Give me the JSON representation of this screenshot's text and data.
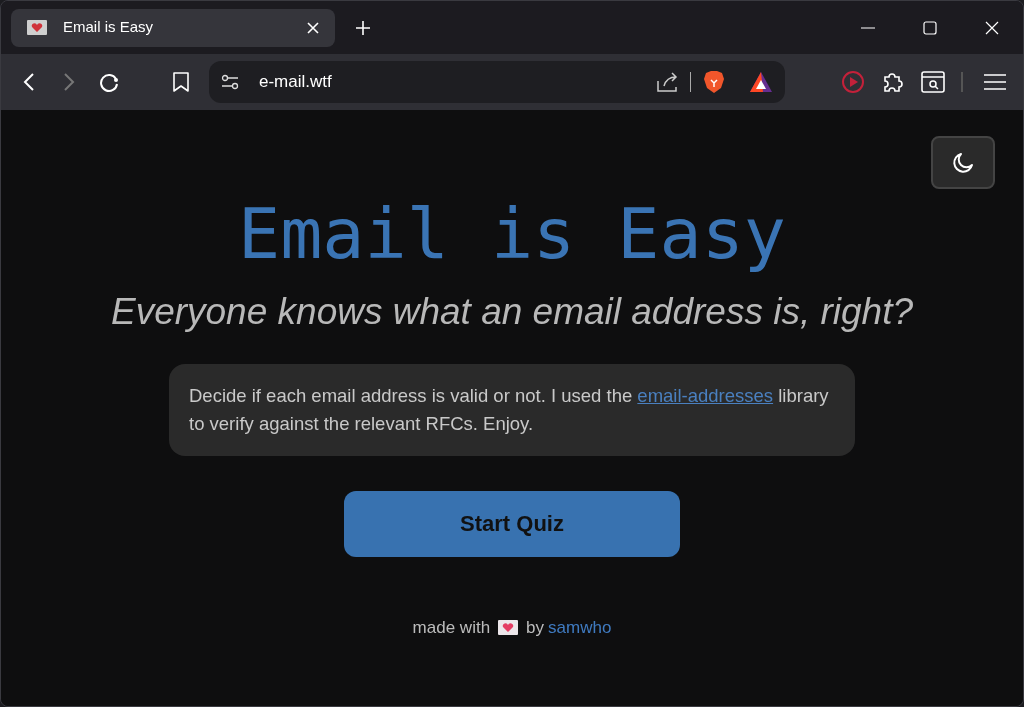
{
  "browser": {
    "tabs": [
      {
        "title": "Email is Easy",
        "selected": true
      }
    ],
    "address": "e-mail.wtf"
  },
  "page": {
    "title": "Email is Easy",
    "subtitle": "Everyone knows what an email address is, right?",
    "intro": {
      "before": "Decide if each email address is valid or not. I used the",
      "link": "email-addresses",
      "after": "library to verify against the relevant RFCs. Enjoy."
    },
    "start_button": "Start Quiz",
    "footer": {
      "before": "made with",
      "by": "by",
      "author": "samwho"
    }
  }
}
